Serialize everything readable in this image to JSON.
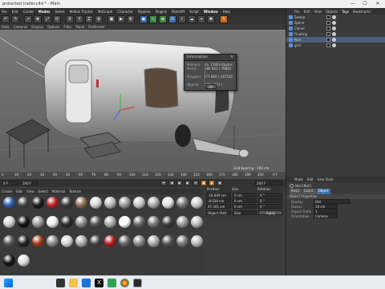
{
  "window": {
    "title": "protected trailer.c4d * - Main",
    "min": "—",
    "max": "☐",
    "close": "✕"
  },
  "menu": [
    "File",
    "Edit",
    "Create",
    "Modes",
    "Select",
    "Motion Tracker",
    "MoGraph",
    "Character",
    "Pipeline",
    "Plugins",
    "Redshift",
    "Script",
    "Window",
    "Help"
  ],
  "toolbar": {
    "x": "X",
    "y": "Y",
    "z": "Z"
  },
  "viewbar": [
    "View",
    "Cameras",
    "Display",
    "Options",
    "Filter",
    "Panel",
    "ProRender"
  ],
  "viewport": {
    "grid_spacing": "Grid Spacing : 100 cm"
  },
  "info_popup": {
    "title": "Information",
    "rows": [
      {
        "label": "Memory",
        "value": "ca. 11803 Kbytes"
      },
      {
        "label": "Points",
        "value": "184 941 ( 79881 )"
      },
      {
        "label": "Polygons",
        "value": "177 860 ( 167534 )"
      },
      {
        "label": "Objects",
        "value": "289 ( 871 )"
      }
    ],
    "ok": "OK"
  },
  "timeline": {
    "ticks": [
      "0",
      "10",
      "20",
      "30",
      "40",
      "50",
      "60",
      "70",
      "80",
      "90",
      "100",
      "110",
      "120",
      "130",
      "140",
      "150",
      "160",
      "170",
      "180",
      "190",
      "200"
    ],
    "frame": "0 F"
  },
  "transport": {
    "start": "0 F",
    "end": "200 F",
    "current": "200 F"
  },
  "materials": {
    "menu": [
      "Create",
      "Edit",
      "View",
      "Select",
      "Material",
      "Texture"
    ]
  },
  "coordinates": {
    "headers": [
      "Position",
      "Size",
      "Rotation"
    ],
    "rows": [
      {
        "p": "-16.009 cm",
        "s": "0 cm",
        "r": "0 °"
      },
      {
        "p": "-8.039 cm",
        "s": "0 cm",
        "r": "0 °"
      },
      {
        "p": "47.341 cm",
        "s": "0 cm",
        "r": "0 °"
      }
    ],
    "mode": "Object (Rel)",
    "size_mode": "Size",
    "apply": "Apply"
  },
  "object_manager": {
    "menu": [
      "File",
      "Edit",
      "View",
      "Objects",
      "Tags",
      "Bookmarks"
    ],
    "objects": [
      "Sweep",
      "Spline",
      "Cloner",
      "Floating",
      "Null",
      "grid"
    ]
  },
  "attributes": {
    "menu": [
      "Mode",
      "Edit",
      "User Data"
    ],
    "object_name": "Null [Null]",
    "tabs": [
      "Basic",
      "Coord.",
      "Object"
    ],
    "section": "Object Properties",
    "props": [
      {
        "label": "Display",
        "value": "Dot"
      },
      {
        "label": "Radius",
        "value": "10 cm"
      },
      {
        "label": "Aspect Ratio",
        "value": "1"
      },
      {
        "label": "Orientation",
        "value": "Camera"
      }
    ]
  },
  "taskbar": {
    "time": "",
    "date": ""
  }
}
